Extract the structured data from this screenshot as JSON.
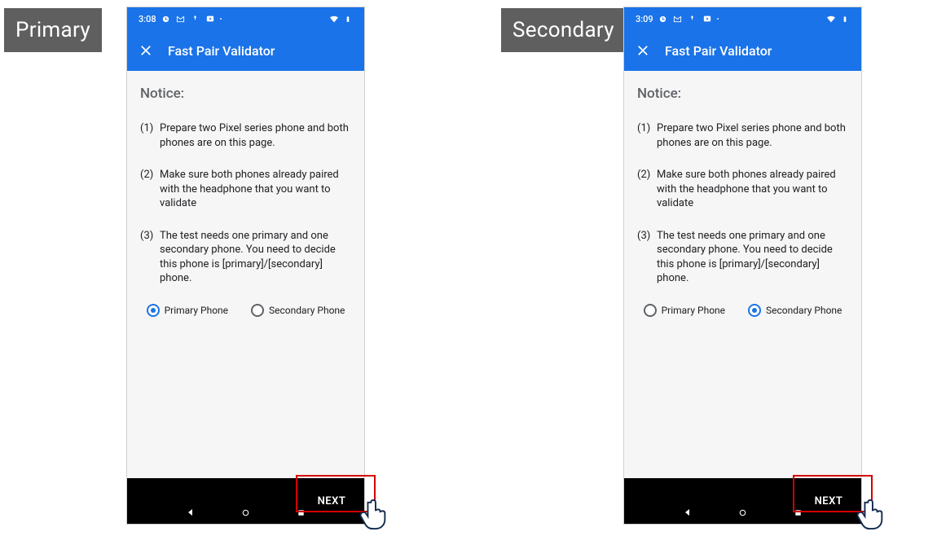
{
  "left": {
    "tag": "Primary",
    "status_time": "3:08",
    "appbar_title": "Fast Pair Validator",
    "notice_heading": "Notice:",
    "steps": {
      "one_num": "(1)",
      "one_text": "Prepare two Pixel series phone and both phones are on this page.",
      "two_num": "(2)",
      "two_text": "Make sure both phones already paired with the headphone that you want to validate",
      "three_num": "(3)",
      "three_text": "The test needs one primary and one secondary phone. You need to decide this phone is [primary]/[secondary] phone."
    },
    "radio": {
      "primary_label": "Primary Phone",
      "secondary_label": "Secondary Phone",
      "selected": "primary"
    },
    "next_label": "NEXT"
  },
  "right": {
    "tag": "Secondary",
    "status_time": "3:09",
    "appbar_title": "Fast Pair Validator",
    "notice_heading": "Notice:",
    "steps": {
      "one_num": "(1)",
      "one_text": "Prepare two Pixel series phone and both phones are on this page.",
      "two_num": "(2)",
      "two_text": "Make sure both phones already paired with the headphone that you want to validate",
      "three_num": "(3)",
      "three_text": "The test needs one primary and one secondary phone. You need to decide this phone is [primary]/[secondary] phone."
    },
    "radio": {
      "primary_label": "Primary Phone",
      "secondary_label": "Secondary Phone",
      "selected": "secondary"
    },
    "next_label": "NEXT"
  },
  "colors": {
    "accent": "#1a73e8",
    "highlight": "#d40000"
  }
}
